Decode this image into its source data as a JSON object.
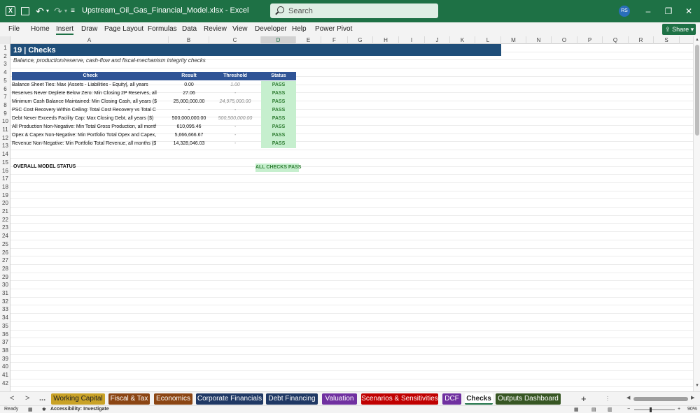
{
  "window": {
    "filename": "Upstream_Oil_Gas_Financial_Model.xlsx",
    "app": "Excel",
    "separator": "-",
    "search_placeholder": "Search",
    "avatar_initials": "RS"
  },
  "colors": {
    "excel_green": "#1e7145",
    "title_band": "#1f4e79",
    "table_header": "#2f5496",
    "pass_fill": "#c6efce",
    "pass_text": "#2e7d32"
  },
  "ribbon": {
    "tabs": [
      "File",
      "Home",
      "Insert",
      "Draw",
      "Page Layout",
      "Formulas",
      "Data",
      "Review",
      "View",
      "Developer",
      "Help",
      "Power Pivot"
    ],
    "active_tab": "Insert",
    "share_label": "Share"
  },
  "grid": {
    "columns": [
      "A",
      "B",
      "C",
      "D",
      "E",
      "F",
      "G",
      "H",
      "I",
      "J",
      "K",
      "L",
      "M",
      "N",
      "O",
      "P",
      "Q",
      "R",
      "S"
    ],
    "selected_column": "D",
    "row_count": 42
  },
  "sheet": {
    "title": "19  |  Checks",
    "subtitle": "Balance, production/reserve, cash-flow and fiscal-mechanism integrity checks",
    "headers": {
      "check": "Check",
      "result": "Result",
      "threshold": "Threshold",
      "status": "Status"
    },
    "rows": [
      {
        "check": "Balance Sheet Ties: Max |Assets - Liabilities - Equity|, all years",
        "result": "0.00",
        "threshold": "1.00",
        "status": "PASS"
      },
      {
        "check": "Reserves Never Deplete Below Zero: Min Closing 2P Reserves, all",
        "result": "27.06",
        "threshold": "-",
        "status": "PASS"
      },
      {
        "check": "Minimum Cash Balance Maintained: Min Closing Cash, all years ($",
        "result": "25,000,000.00",
        "threshold": "24,975,000.00",
        "status": "PASS"
      },
      {
        "check": "PSC Cost Recovery Within Ceiling: Total Cost Recovery vs Total C",
        "result": "-",
        "threshold": "-",
        "status": "PASS"
      },
      {
        "check": "Debt Never Exceeds Facility Cap: Max Closing Debt, all years ($)",
        "result": "500,000,000.00",
        "threshold": "500,500,000.00",
        "status": "PASS"
      },
      {
        "check": "All Production Non-Negative: Min Total Gross Production, all montf",
        "result": "610,095.46",
        "threshold": "-",
        "status": "PASS"
      },
      {
        "check": "Opex & Capex Non-Negative: Min Portfolio Total Opex and Capex,",
        "result": "5,666,666.67",
        "threshold": "-",
        "status": "PASS"
      },
      {
        "check": "Revenue Non-Negative: Min Portfolio Total Revenue, all months ($",
        "result": "14,328,046.03",
        "threshold": "-",
        "status": "PASS"
      }
    ],
    "overall_label": "OVERALL MODEL STATUS",
    "overall_value": "ALL CHECKS PASS"
  },
  "tabs": {
    "nav_prev": "<",
    "nav_next": ">",
    "nav_more": "...",
    "sheets": [
      {
        "name": "Working Capital",
        "bg": "#c9a227",
        "fg": "#222"
      },
      {
        "name": "Fiscal & Tax",
        "bg": "#8b4513",
        "fg": "#fff"
      },
      {
        "name": "Economics",
        "bg": "#8b4513",
        "fg": "#fff"
      },
      {
        "name": "Corporate Financials",
        "bg": "#1f3864",
        "fg": "#fff"
      },
      {
        "name": "Debt Financing",
        "bg": "#1f3864",
        "fg": "#fff"
      },
      {
        "name": "Valuation",
        "bg": "#7030a0",
        "fg": "#fff"
      },
      {
        "name": "Scenarios & Sensitivities",
        "bg": "#c00000",
        "fg": "#fff"
      },
      {
        "name": "DCF",
        "bg": "#7030a0",
        "fg": "#fff"
      },
      {
        "name": "Checks",
        "bg": "#ffffff",
        "fg": "#222"
      },
      {
        "name": "Outputs Dashboard",
        "bg": "#375623",
        "fg": "#fff"
      }
    ],
    "active_sheet": "Checks",
    "add_label": "+",
    "separator_label": "⋮"
  },
  "status": {
    "ready": "Ready",
    "accessibility": "Accessibility: Investigate",
    "zoom_minus": "−",
    "zoom_plus": "+",
    "zoom": "90%"
  }
}
